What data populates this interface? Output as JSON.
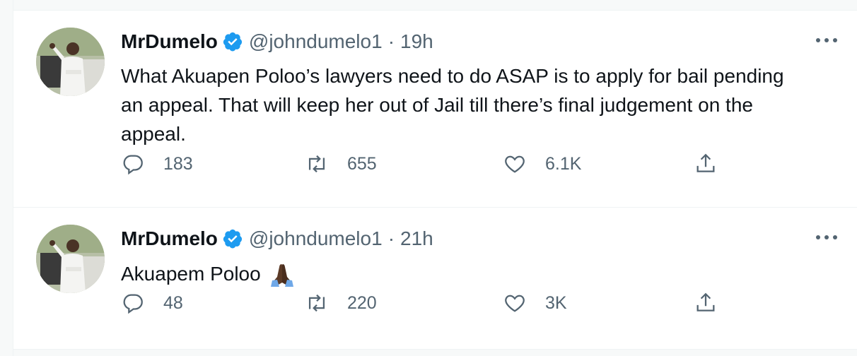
{
  "tweets": [
    {
      "display_name": "MrDumelo",
      "handle": "@johndumelo1",
      "separator": "·",
      "time": "19h",
      "text": "What Akuapen Poloo’s lawyers need to do ASAP is to apply for bail pending an appeal. That will keep her out of Jail till there’s final judgement on the appeal.",
      "emoji": "",
      "replies": "183",
      "retweets": "655",
      "likes": "6.1K"
    },
    {
      "display_name": "MrDumelo",
      "handle": "@johndumelo1",
      "separator": "·",
      "time": "21h",
      "text": "Akuapem Poloo",
      "emoji": "folded-hands",
      "replies": "48",
      "retweets": "220",
      "likes": "3K"
    }
  ],
  "icons": {
    "verified": "verified-badge-icon",
    "more": "more-options-icon",
    "reply": "reply-icon",
    "retweet": "retweet-icon",
    "like": "heart-icon",
    "share": "share-icon"
  },
  "colors": {
    "verified_blue": "#1d9bf0",
    "text": "#0f1419",
    "secondary": "#536471"
  }
}
